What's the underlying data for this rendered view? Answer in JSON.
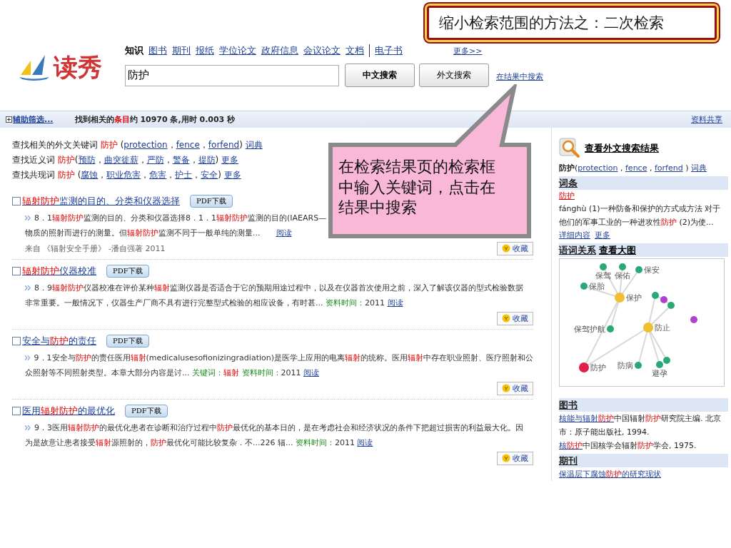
{
  "callouts": {
    "title": "缩小检索范围的方法之：二次检索",
    "tip": "在检索结果页的检索框中输入关键词，点击在结果中搜索"
  },
  "logo": "读秀",
  "nav": [
    {
      "label": "知识",
      "selected": true,
      "divided": false
    },
    {
      "label": "图书",
      "selected": false,
      "divided": false
    },
    {
      "label": "期刊",
      "selected": false,
      "divided": false
    },
    {
      "label": "报纸",
      "selected": false,
      "divided": false
    },
    {
      "label": "学位论文",
      "selected": false,
      "divided": false
    },
    {
      "label": "政府信息",
      "selected": false,
      "divided": false
    },
    {
      "label": "会议论文",
      "selected": false,
      "divided": false
    },
    {
      "label": "文档",
      "selected": false,
      "divided": false
    },
    {
      "label": "电子书",
      "selected": false,
      "divided": true
    }
  ],
  "nav_more": "更多>>",
  "search": {
    "value": "防护",
    "buttons": [
      {
        "label": "中文搜索",
        "primary": true
      },
      {
        "label": "外文搜索",
        "primary": false
      }
    ],
    "within_link": "在结果中搜索"
  },
  "summary": {
    "toggle": "辅助筛选...",
    "text": [
      {
        "text": "找到相关的"
      },
      {
        "text": "条目",
        "highlight": true
      },
      {
        "text": "约 10970 条,用时 0.003 秒"
      }
    ],
    "share": "资料共享"
  },
  "related": [
    [
      {
        "text": "查找相关的外文关键词 "
      },
      {
        "text": "防护",
        "highlight": true
      },
      {
        "text": " ("
      },
      {
        "text": "protection",
        "link": true
      },
      {
        "text": "，"
      },
      {
        "text": "fence",
        "link": true
      },
      {
        "text": "，"
      },
      {
        "text": "forfend",
        "link": true
      },
      {
        "text": ") "
      },
      {
        "text": "词典",
        "link": true
      }
    ],
    [
      {
        "text": "查找近义词 "
      },
      {
        "text": "防护",
        "highlight": true
      },
      {
        "text": "("
      },
      {
        "text": "预防",
        "link": true
      },
      {
        "text": "，"
      },
      {
        "text": "曲突徙薪",
        "link": true
      },
      {
        "text": "，"
      },
      {
        "text": "严防",
        "link": true
      },
      {
        "text": "，"
      },
      {
        "text": "警备",
        "link": true
      },
      {
        "text": "，"
      },
      {
        "text": "提防",
        "link": true
      },
      {
        "text": ") "
      },
      {
        "text": "更多",
        "link": true
      }
    ],
    [
      {
        "text": "查找共现词 "
      },
      {
        "text": "防护",
        "highlight": true
      },
      {
        "text": " ("
      },
      {
        "text": "腐蚀",
        "link": true
      },
      {
        "text": "，"
      },
      {
        "text": "职业危害",
        "link": true
      },
      {
        "text": "，"
      },
      {
        "text": "危害",
        "link": true
      },
      {
        "text": "，"
      },
      {
        "text": "护士",
        "link": true
      },
      {
        "text": "，"
      },
      {
        "text": "安全",
        "link": true
      },
      {
        "text": ") "
      },
      {
        "text": "更多",
        "link": true
      }
    ]
  ],
  "results": [
    {
      "checked": false,
      "title": [
        {
          "text": "辐射防护",
          "highlight": true
        },
        {
          "text": "监测的目的、分类和仪器选择"
        }
      ],
      "pdf": "PDF下载",
      "favorite": "收藏",
      "source": "来自 《辐射安全手册》 -潘自强著 2011",
      "lines": [
        [
          {
            "text": "8．1"
          },
          {
            "text": "辐射防护",
            "highlight": true
          },
          {
            "text": "监测的目的、分类和仪器选择8．1．1"
          },
          {
            "text": "辐射防护",
            "highlight": true
          },
          {
            "text": "监测的目的(IAEARS—"
          }
        ],
        [
          {
            "text": "物质的照射而进行的测量。但"
          },
          {
            "text": "辐射防护",
            "highlight": true
          },
          {
            "text": "监测不同于一般单纯的测量...　　"
          },
          {
            "text": "阅读",
            "link": true
          }
        ]
      ]
    },
    {
      "checked": false,
      "title": [
        {
          "text": "辐射防护",
          "highlight": true
        },
        {
          "text": "仪器校准"
        }
      ],
      "pdf": "PDF下载",
      "favorite": "收藏",
      "lines": [
        [
          {
            "text": "8．9"
          },
          {
            "text": "辐射防护",
            "highlight": true
          },
          {
            "text": "仪器校准在评价某种"
          },
          {
            "text": "辐射",
            "highlight": true
          },
          {
            "text": "监测仪器是否适合于它的预期用途过程中，以及在仪器首次使用之前，深入了解该仪器的型式检验数据"
          }
        ],
        [
          {
            "text": "非常重要。一般情况下，仪器生产厂商不具有进行完整型式检验的相应设备，有时甚... "
          },
          {
            "text": "资料时间：",
            "note": true
          },
          {
            "text": "2011 "
          },
          {
            "text": "阅读",
            "link": true
          }
        ]
      ]
    },
    {
      "checked": false,
      "title": [
        {
          "text": "安全与"
        },
        {
          "text": "防护",
          "highlight": true
        },
        {
          "text": "的责任"
        }
      ],
      "pdf": "PDF下载",
      "favorite": "收藏",
      "lines": [
        [
          {
            "text": "9．1安全与"
          },
          {
            "text": "防护",
            "highlight": true
          },
          {
            "text": "的责任医用"
          },
          {
            "text": "辐射",
            "highlight": true
          },
          {
            "text": "(medicalusesofionizingradiation)是医学上应用的电离"
          },
          {
            "text": "辐射",
            "highlight": true
          },
          {
            "text": "的统称。医用"
          },
          {
            "text": "辐射",
            "highlight": true
          },
          {
            "text": "中存在职业照射、医疗照射和公"
          }
        ],
        [
          {
            "text": "众照射等不同照射类型。本章大部分内容是讨... "
          },
          {
            "text": "关键词：",
            "note": true
          },
          {
            "text": "辐射 ",
            "highlight": true
          },
          {
            "text": "资料时间：",
            "note": true
          },
          {
            "text": "2011 "
          },
          {
            "text": "阅读",
            "link": true
          }
        ]
      ]
    },
    {
      "checked": false,
      "title": [
        {
          "text": "医用"
        },
        {
          "text": "辐射防护",
          "highlight": true
        },
        {
          "text": "的最优化"
        }
      ],
      "pdf": "PDF下载",
      "favorite": "收藏",
      "lines": [
        [
          {
            "text": "9．3医用"
          },
          {
            "text": "辐射防护",
            "highlight": true
          },
          {
            "text": "的最优化患者在诊断和治疗过程中"
          },
          {
            "text": "防护",
            "highlight": true
          },
          {
            "text": "最优化的基本日的，是在考虑社会和经济状况的条件下把超过损害的利益最大化。因"
          }
        ],
        [
          {
            "text": "为是故意让患者接受"
          },
          {
            "text": "辐射",
            "highlight": true
          },
          {
            "text": "源照射的，"
          },
          {
            "text": "防护",
            "highlight": true
          },
          {
            "text": "最优化可能比较复杂．不...226 辐... "
          },
          {
            "text": "资料时间：",
            "note": true
          },
          {
            "text": "2011 "
          },
          {
            "text": "阅读",
            "link": true
          }
        ]
      ]
    }
  ],
  "sidebar": {
    "foreign_link": "查看外文搜索结果",
    "foreign_line": [
      {
        "text": "防护",
        "bold": true
      },
      {
        "text": "("
      },
      {
        "text": "protection",
        "link": true
      },
      {
        "text": " , "
      },
      {
        "text": "fence",
        "link": true
      },
      {
        "text": " , "
      },
      {
        "text": "forfend",
        "link": true
      },
      {
        "text": " ) "
      },
      {
        "text": "词典",
        "link": true
      }
    ],
    "entry": {
      "heading": "词条",
      "word": "防护",
      "definition": [
        {
          "text": "fánghù (1)一种防备和保护的方式或方法 对于他们的军事工业的一种进攻性"
        },
        {
          "text": "防护",
          "highlight": true
        },
        {
          "text": " (2)为使..."
        }
      ],
      "links": [
        "详细内容",
        "更多"
      ]
    },
    "relations": {
      "heading": "语词关系",
      "link": "查看大图",
      "nodes": [
        {
          "label": "保护",
          "color": "#f0c030"
        },
        {
          "label": "保驾",
          "color": "#2aa876"
        },
        {
          "label": "保佑",
          "color": "#2aa876"
        },
        {
          "label": "保安",
          "color": "#2aa876"
        },
        {
          "label": "保胎",
          "color": "#2aa876"
        },
        {
          "label": "保驾护航",
          "color": "#2aa876"
        },
        {
          "label": "防护",
          "color": "#e0204a"
        },
        {
          "label": "防止",
          "color": "#f0c030"
        },
        {
          "color": "#2aa876"
        },
        {
          "color": "#b040d0"
        },
        {
          "color": "#2aa876"
        },
        {
          "color": "#b040d0"
        },
        {
          "label": "防病",
          "color": "#2aa876"
        },
        {
          "label": "避孕",
          "color": "#2aa876"
        },
        {
          "color": "#2aa876"
        }
      ]
    },
    "books": {
      "heading": "图书",
      "items": [
        {
          "title": [
            {
              "text": "核能与辐射"
            },
            {
              "text": "防护",
              "highlight": true
            }
          ],
          "rest": [
            {
              "text": "中国辐射"
            },
            {
              "text": "防护",
              "highlight": true
            },
            {
              "text": "研究院主编. 北京市：原子能出版社, 1994."
            }
          ]
        },
        {
          "title": [
            {
              "text": "核"
            },
            {
              "text": "防护",
              "highlight": true
            }
          ],
          "rest": [
            {
              "text": "中国核学会辐射"
            },
            {
              "text": "防护",
              "highlight": true
            },
            {
              "text": "学会, 1975."
            }
          ]
        }
      ]
    },
    "journals": {
      "heading": "期刊",
      "items": [
        {
          "title": [
            {
              "text": "保温层下腐蚀"
            },
            {
              "text": "防护",
              "highlight": true
            },
            {
              "text": "的研究现状"
            }
          ]
        }
      ]
    }
  }
}
